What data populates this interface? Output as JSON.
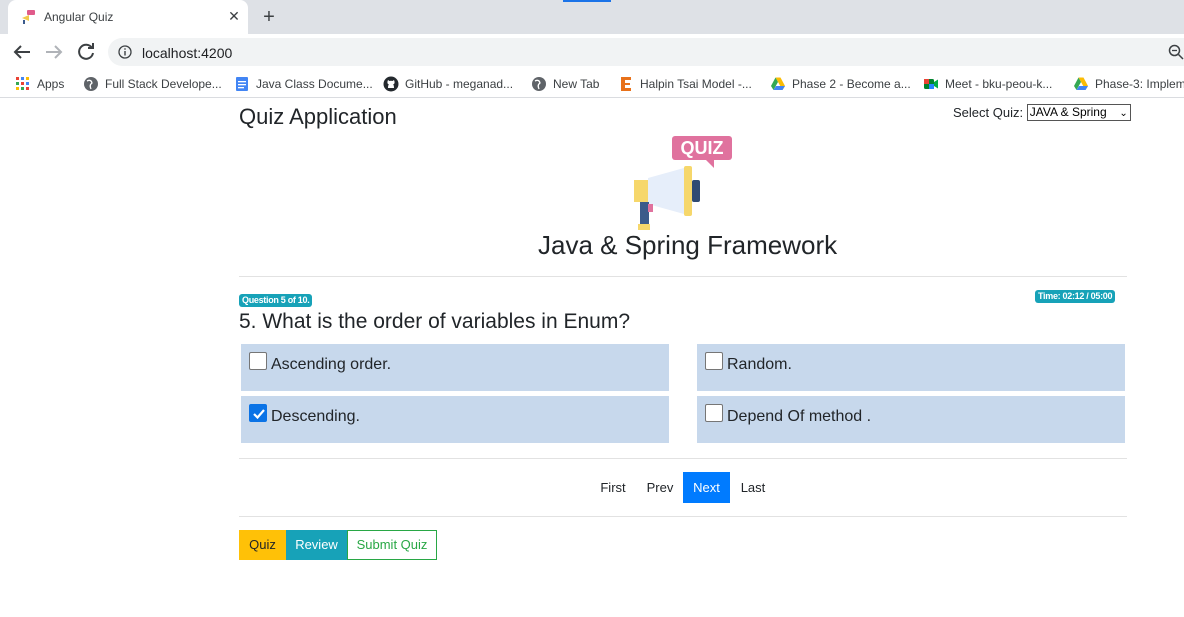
{
  "browser": {
    "tab_title": "Angular Quiz",
    "url": "localhost:4200",
    "bookmarks": [
      {
        "label": "Apps",
        "icon": "apps-grid-icon"
      },
      {
        "label": "Full Stack Develope...",
        "icon": "globe-icon"
      },
      {
        "label": "Java Class Docume...",
        "icon": "docs-icon"
      },
      {
        "label": "GitHub - meganad...",
        "icon": "github-icon"
      },
      {
        "label": "New Tab",
        "icon": "globe-icon"
      },
      {
        "label": "Halpin Tsai Model -...",
        "icon": "e-icon"
      },
      {
        "label": "Phase 2 - Become a...",
        "icon": "drive-icon"
      },
      {
        "label": "Meet - bku-peou-k...",
        "icon": "meet-icon"
      },
      {
        "label": "Phase-3: Implem",
        "icon": "drive-icon"
      }
    ]
  },
  "app": {
    "title": "Quiz Application",
    "select_label": "Select Quiz:",
    "selected_quiz": "JAVA & Spring",
    "logo_text": "QUIZ",
    "quiz_name": "Java & Spring Framework"
  },
  "question": {
    "counter_badge": "Question 5 of 10.",
    "time_badge": "Time: 02:12 / 05:00",
    "text": "5. What is the order of variables in Enum?",
    "options": [
      {
        "label": "Ascending order.",
        "checked": false
      },
      {
        "label": "Random.",
        "checked": false
      },
      {
        "label": "Descending.",
        "checked": true
      },
      {
        "label": "Depend Of method .",
        "checked": false
      }
    ]
  },
  "pager": {
    "first": "First",
    "prev": "Prev",
    "next": "Next",
    "last": "Last",
    "active": "Next"
  },
  "modes": {
    "quiz": "Quiz",
    "review": "Review",
    "submit": "Submit Quiz"
  },
  "colors": {
    "option_bg": "#c7d8ec",
    "badge": "#17a2b8",
    "primary": "#007bff",
    "warning": "#ffc107",
    "success": "#28a745"
  }
}
